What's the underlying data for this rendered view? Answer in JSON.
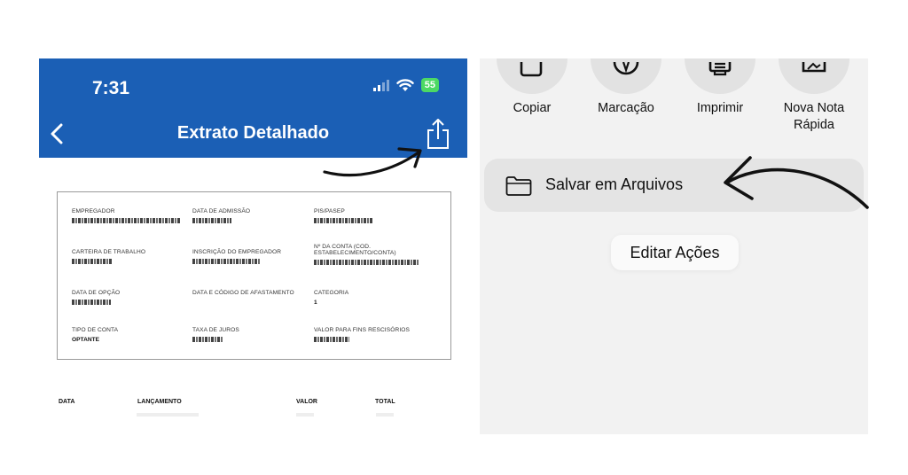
{
  "left": {
    "status": {
      "time": "7:31",
      "battery": "55"
    },
    "nav": {
      "title": "Extrato Detalhado"
    },
    "fields": [
      {
        "label": "EMPREGADOR"
      },
      {
        "label": "DATA DE ADMISSÃO"
      },
      {
        "label": "PIS/PASEP"
      },
      {
        "label": "CARTEIRA DE TRABALHO"
      },
      {
        "label": "INSCRIÇÃO DO EMPREGADOR"
      },
      {
        "label": "Nº DA CONTA (COD. ESTABELECIMENTO/CONTA)"
      },
      {
        "label": "DATA DE OPÇÃO"
      },
      {
        "label": "DATA E CÓDIGO DE AFASTAMENTO"
      },
      {
        "label": "CATEGORIA",
        "value": "1"
      },
      {
        "label": "TIPO DE CONTA",
        "value": "OPTANTE"
      },
      {
        "label": "TAXA DE JUROS"
      },
      {
        "label": "VALOR PARA FINS RESCISÓRIOS"
      }
    ],
    "table_headers": [
      "DATA",
      "LANÇAMENTO",
      "VALOR",
      "TOTAL"
    ]
  },
  "right": {
    "actions": [
      {
        "label": "Copiar",
        "icon": "copy-icon"
      },
      {
        "label": "Marcação",
        "icon": "markup-icon"
      },
      {
        "label": "Imprimir",
        "icon": "print-icon"
      },
      {
        "label": "Nova Nota Rápida",
        "icon": "quick-note-icon"
      }
    ],
    "save_files": "Salvar em Arquivos",
    "edit_actions": "Editar Ações"
  },
  "colors": {
    "header_blue": "#1b5fb5",
    "battery_green": "#4cd964"
  }
}
